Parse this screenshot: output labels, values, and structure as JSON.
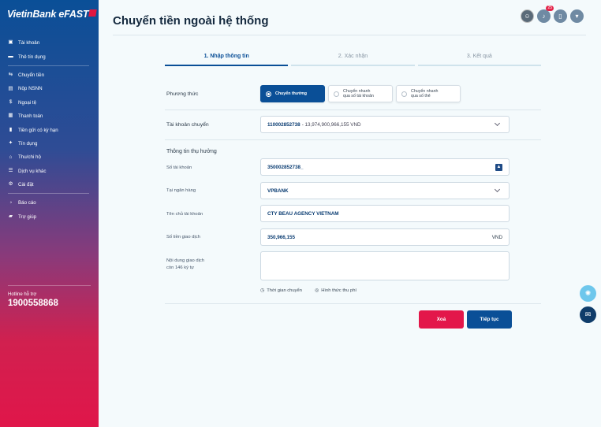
{
  "brand": {
    "name": "VietinBank eFAST"
  },
  "sidebar": {
    "items": [
      {
        "label": "Tài khoản",
        "icon": "wallet-icon"
      },
      {
        "label": "Thẻ tín dụng",
        "icon": "card-icon"
      },
      {
        "label": "Chuyển tiền",
        "icon": "transfer-icon"
      },
      {
        "label": "Nộp NSNN",
        "icon": "tax-icon"
      },
      {
        "label": "Ngoại tệ",
        "icon": "currency-icon"
      },
      {
        "label": "Thanh toán",
        "icon": "payment-icon"
      },
      {
        "label": "Tiền gửi có kỳ hạn",
        "icon": "deposit-icon"
      },
      {
        "label": "Tín dụng",
        "icon": "credit-icon"
      },
      {
        "label": "Thu/chi hộ",
        "icon": "collect-icon"
      },
      {
        "label": "Dịch vụ khác",
        "icon": "services-icon"
      },
      {
        "label": "Cài đặt",
        "icon": "gear-icon"
      },
      {
        "label": "Báo cáo",
        "icon": "report-icon"
      },
      {
        "label": "Trợ giúp",
        "icon": "help-icon"
      }
    ],
    "hotline_label": "Hotline hỗ trợ",
    "hotline_number": "1900558868"
  },
  "header": {
    "title": "Chuyển tiền ngoài hệ thống",
    "notification_count": "25"
  },
  "steps": [
    {
      "label": "1. Nhập thông tin",
      "active": true
    },
    {
      "label": "2. Xác nhận",
      "active": false
    },
    {
      "label": "3. Kết quả",
      "active": false
    }
  ],
  "form": {
    "method_label": "Phương thức",
    "methods": [
      {
        "line1": "Chuyển thường",
        "line2": "",
        "selected": true
      },
      {
        "line1": "Chuyển nhanh",
        "line2": "qua số tài khoản",
        "selected": false
      },
      {
        "line1": "Chuyển nhanh",
        "line2": "qua số thẻ",
        "selected": false
      }
    ],
    "source_account_label": "Tài khoản chuyển",
    "source_account_number": "110002852738",
    "source_account_balance": "- 13,974,900,966,155 VND",
    "beneficiary_section": "Thông tin thụ hưởng",
    "account_no_label": "Số tài khoản",
    "account_no_value": "350002852738_",
    "bank_label": "Tại ngân hàng",
    "bank_value": "VPBANK",
    "holder_label": "Tên chủ tài khoản",
    "holder_value": "CTY BEAU AGENCY VIETNAM",
    "amount_label": "Số tiền giao dịch",
    "amount_value": "350,966,155",
    "amount_currency": "VND",
    "content_label_1": "Nội dung giao dịch",
    "content_label_2": "còn 146 ký tự",
    "link_time": "Thời gian chuyển",
    "link_fee": "Hình thức thu phí",
    "delete_label": "Xoá",
    "continue_label": "Tiếp tục"
  },
  "colors": {
    "primary": "#0a4f97",
    "danger": "#e3174a"
  }
}
